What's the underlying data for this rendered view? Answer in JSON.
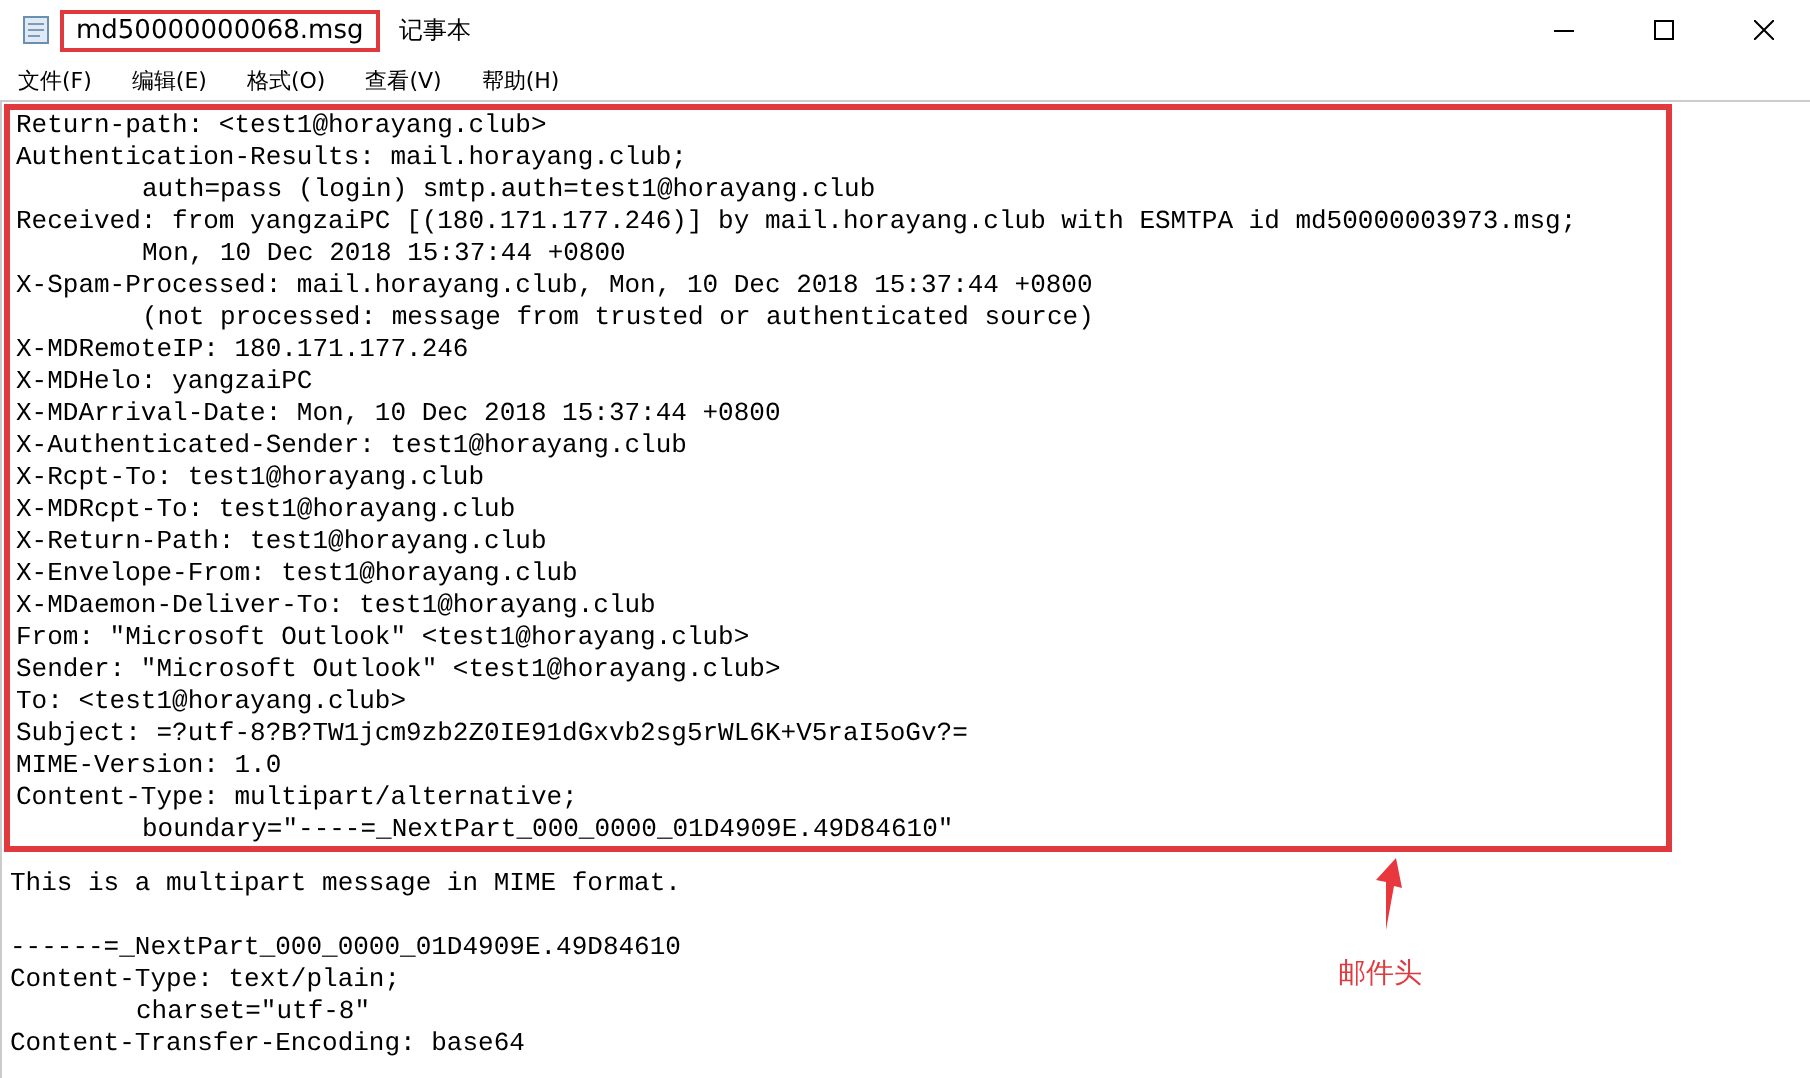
{
  "window": {
    "file_name": "md50000000068.msg",
    "app_name": "记事本"
  },
  "menu": [
    "文件(F)",
    "编辑(E)",
    "格式(O)",
    "查看(V)",
    "帮助(H)"
  ],
  "header_lines": [
    {
      "text": "Return-path: <test1@horayang.club>",
      "indented": false
    },
    {
      "text": "Authentication-Results: mail.horayang.club;",
      "indented": false
    },
    {
      "text": "auth=pass (login) smtp.auth=test1@horayang.club",
      "indented": true
    },
    {
      "text": "Received: from yangzaiPC [(180.171.177.246)] by mail.horayang.club with ESMTPA id md50000003973.msg;",
      "indented": false
    },
    {
      "text": "Mon, 10 Dec 2018 15:37:44 +0800",
      "indented": true
    },
    {
      "text": "X-Spam-Processed: mail.horayang.club, Mon, 10 Dec 2018 15:37:44 +0800",
      "indented": false
    },
    {
      "text": "(not processed: message from trusted or authenticated source)",
      "indented": true
    },
    {
      "text": "X-MDRemoteIP: 180.171.177.246",
      "indented": false
    },
    {
      "text": "X-MDHelo: yangzaiPC",
      "indented": false
    },
    {
      "text": "X-MDArrival-Date: Mon, 10 Dec 2018 15:37:44 +0800",
      "indented": false
    },
    {
      "text": "X-Authenticated-Sender: test1@horayang.club",
      "indented": false
    },
    {
      "text": "X-Rcpt-To: test1@horayang.club",
      "indented": false
    },
    {
      "text": "X-MDRcpt-To: test1@horayang.club",
      "indented": false
    },
    {
      "text": "X-Return-Path: test1@horayang.club",
      "indented": false
    },
    {
      "text": "X-Envelope-From: test1@horayang.club",
      "indented": false
    },
    {
      "text": "X-MDaemon-Deliver-To: test1@horayang.club",
      "indented": false
    },
    {
      "text": "From: ″Microsoft Outlook″ <test1@horayang.club>",
      "indented": false
    },
    {
      "text": "Sender: ″Microsoft Outlook″ <test1@horayang.club>",
      "indented": false
    },
    {
      "text": "To: <test1@horayang.club>",
      "indented": false
    },
    {
      "text": "Subject: =?utf-8?B?TW1jcm9zb2Z0IE91dGxvb2sg5rWL6K+V5raI5oGv?=",
      "indented": false
    },
    {
      "text": "MIME-Version: 1.0",
      "indented": false
    },
    {
      "text": "Content-Type: multipart/alternative;",
      "indented": false
    },
    {
      "text": "boundary=″----=_NextPart_000_0000_01D4909E.49D84610″",
      "indented": true
    }
  ],
  "body_lines": [
    {
      "kind": "text",
      "text": "This is a multipart message in MIME format.",
      "indented": false
    },
    {
      "kind": "blank"
    },
    {
      "kind": "text",
      "text": "------=_NextPart_000_0000_01D4909E.49D84610",
      "indented": false
    },
    {
      "kind": "text",
      "text": "Content-Type: text/plain;",
      "indented": false
    },
    {
      "kind": "text",
      "text": "charset=″utf-8″",
      "indented": true
    },
    {
      "kind": "text",
      "text": "Content-Transfer-Encoding: base64",
      "indented": false
    }
  ],
  "annotation": {
    "label": "邮件头"
  }
}
